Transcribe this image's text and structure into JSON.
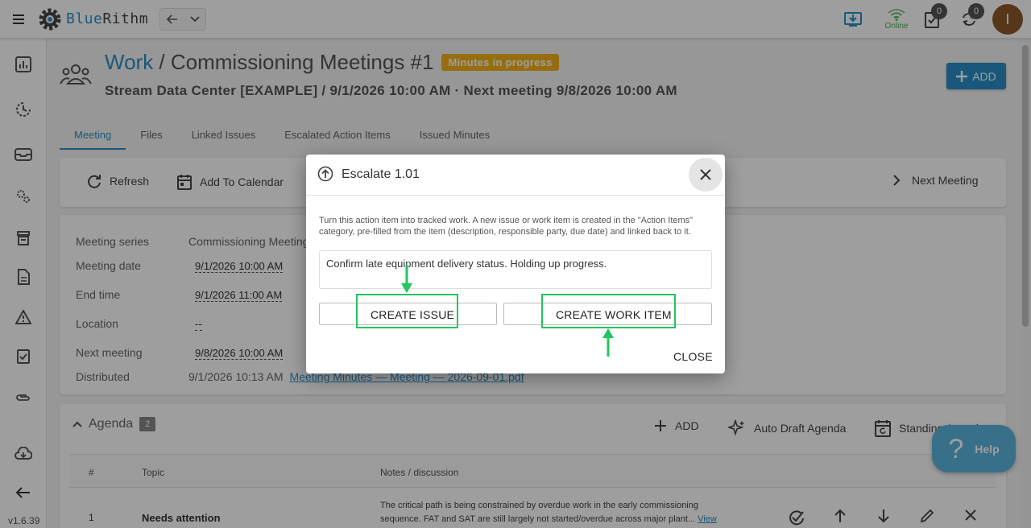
{
  "app": {
    "brand_left": "Blue",
    "brand_right": "Rithm",
    "version": "v1.6.39",
    "online_label": "Online",
    "notifications_count": "0",
    "sync_count": "0",
    "avatar_initial": "I"
  },
  "page": {
    "title_work": "Work",
    "title_sep": " / ",
    "title_rest": "Commissioning Meetings #1",
    "status_badge": "Minutes in progress",
    "subtitle": "Stream Data Center [EXAMPLE] / 9/1/2026 10:00 AM · Next meeting 9/8/2026 10:00 AM",
    "add_label": "ADD"
  },
  "tabs": [
    "Meeting",
    "Files",
    "Linked Issues",
    "Escalated Action Items",
    "Issued Minutes"
  ],
  "toolbar": {
    "refresh": "Refresh",
    "add_to_calendar": "Add To Calendar",
    "next_meeting": "Next Meeting"
  },
  "details": {
    "series_label": "Meeting series",
    "series_value": "Commissioning Meetings",
    "date_label": "Meeting date",
    "date_value": "9/1/2026 10:00 AM",
    "end_label": "End time",
    "end_value": "9/1/2026 11:00 AM",
    "location_label": "Location",
    "location_value": "--",
    "next_label": "Next meeting",
    "next_value": "9/8/2026 10:00 AM",
    "distributed_label": "Distributed",
    "distributed_value": "9/1/2026 10:13 AM",
    "distributed_link": "Meeting Minutes — Meeting — 2026-09-01.pdf"
  },
  "agenda": {
    "title": "Agenda",
    "count": "2",
    "add": "ADD",
    "auto_draft": "Auto Draft Agenda",
    "standing": "Standing Agenda",
    "col_num": "#",
    "col_topic": "Topic",
    "col_notes": "Notes / discussion",
    "rows": [
      {
        "num": "1",
        "topic": "Needs attention",
        "notes": "The critical path is being constrained by overdue work in the early commissioning sequence. FAT and SAT are still largely not started/overdue across major plant... ",
        "view": "View"
      }
    ]
  },
  "help": {
    "label": "Help"
  },
  "dialog": {
    "title": "Escalate 1.01",
    "description": "Turn this action item into tracked work. A new issue or work item is created in the \"Action Items\" category, pre-filled from the item (description, responsible party, due date) and linked back to it.",
    "item_text": "Confirm late equipment delivery status. Holding up progress.",
    "create_issue": "CREATE ISSUE",
    "create_work_item": "CREATE WORK ITEM",
    "close": "CLOSE"
  }
}
